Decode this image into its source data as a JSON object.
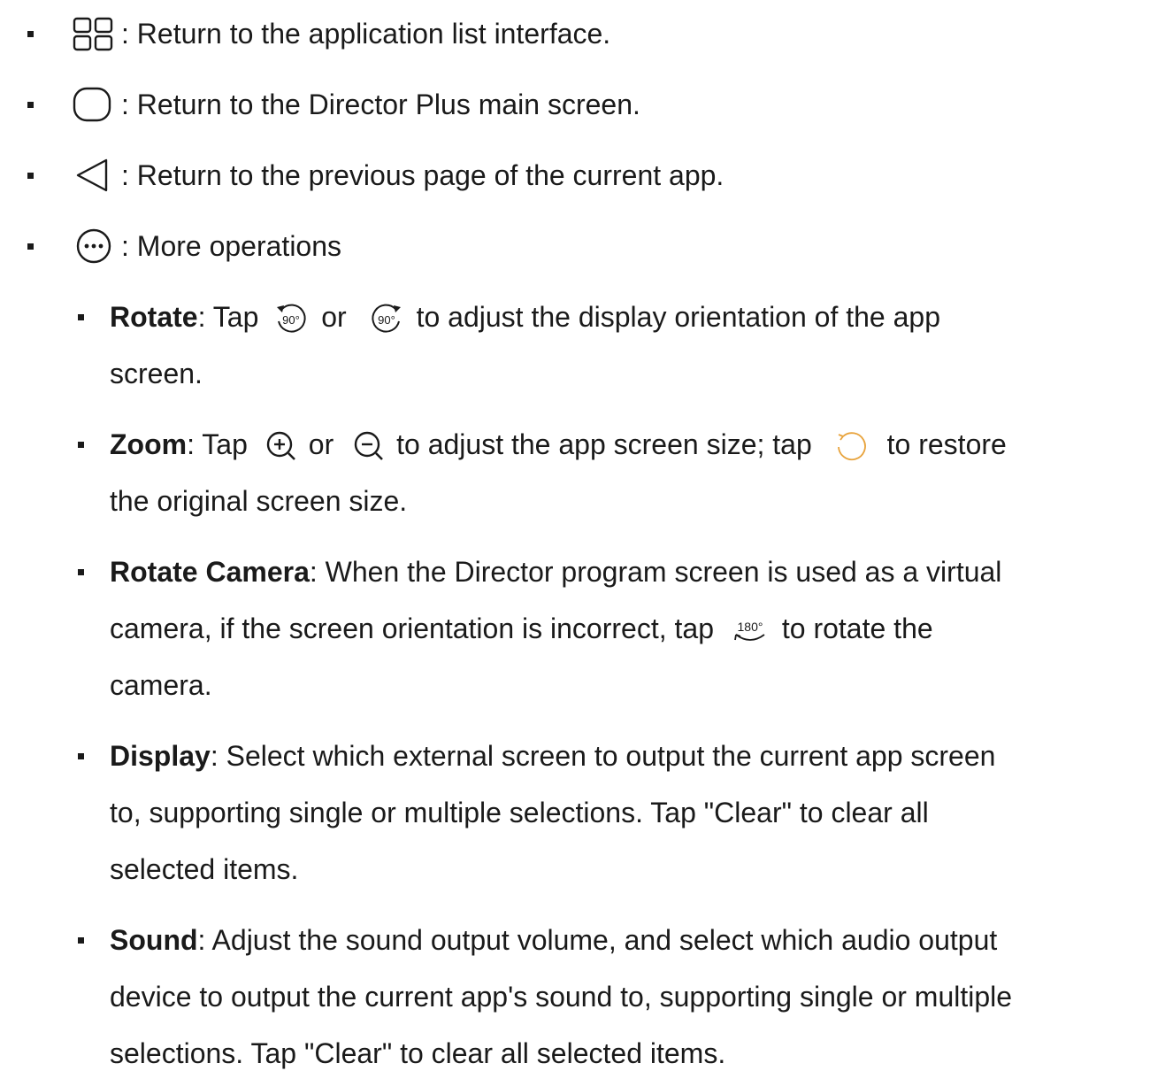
{
  "top_items": [
    {
      "icon": "grid-icon",
      "text": ": Return to the application list interface."
    },
    {
      "icon": "rounded-square-icon",
      "text": ": Return to the Director Plus main screen."
    },
    {
      "icon": "back-triangle-icon",
      "text": ": Return to the previous page of the current app."
    },
    {
      "icon": "more-dots-icon",
      "text": ": More operations"
    }
  ],
  "rotate": {
    "title": "Rotate",
    "t1": ": Tap",
    "icon1_label": "90°",
    "t2": "or",
    "icon2_label": "90°",
    "t3": "to adjust the display orientation of the app",
    "t4": "screen."
  },
  "zoom": {
    "title": "Zoom",
    "t1": ": Tap",
    "t2": "or",
    "t3": "to adjust the app screen size; tap",
    "t4": "to restore",
    "t5": "the original screen size."
  },
  "rotate_camera": {
    "title": "Rotate Camera",
    "l1": ": When the Director program screen is used as a virtual",
    "l2a": "camera, if the screen orientation is incorrect, tap",
    "icon_label": "180°",
    "l2b": "to rotate the",
    "l3": "camera."
  },
  "display": {
    "title": "Display",
    "l1": ": Select which external screen to output the current app screen",
    "l2": "to, supporting single or multiple selections. Tap \"Clear\" to clear all",
    "l3": "selected items."
  },
  "sound": {
    "title": "Sound",
    "l1": ": Adjust the sound output volume, and select which audio output",
    "l2": "device to output the current app's sound to, supporting single or multiple",
    "l3": "selections. Tap \"Clear\" to clear all selected items."
  },
  "colors": {
    "text": "#1a1a1a",
    "restore_icon": "#e8a33c"
  }
}
